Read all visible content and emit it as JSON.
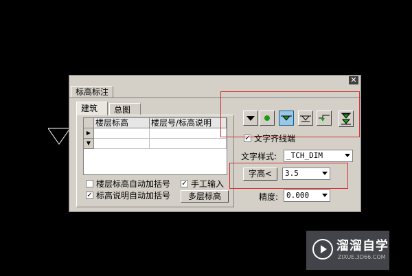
{
  "dialog": {
    "title_tab": "标高标注",
    "close_symbol": "✕"
  },
  "tabs": [
    "建筑",
    "总图"
  ],
  "grid": {
    "columns": [
      "楼层标高",
      "楼层号/标高说明"
    ],
    "row_markers": [
      "▶",
      "▼"
    ]
  },
  "options": {
    "auto_bracket_floor": {
      "label": "楼层标高自动加括号",
      "checked": false
    },
    "manual_input": {
      "label": "手工输入",
      "checked": true
    },
    "auto_bracket_note": {
      "label": "标高说明自动加括号",
      "checked": true
    },
    "multi_level_button": "多层标高"
  },
  "style_buttons": [
    {
      "name": "filled-down-triangle-icon",
      "selected": false
    },
    {
      "name": "circle-dot-icon",
      "selected": false
    },
    {
      "name": "flat-triangle-icon",
      "selected": true
    },
    {
      "name": "leader-triangle-icon",
      "selected": false
    },
    {
      "name": "step-triangle-icon",
      "selected": false
    },
    {
      "name": "double-triangle-icon",
      "selected": false
    }
  ],
  "text_align_end": {
    "label": "文字齐线端",
    "checked": true
  },
  "text_style": {
    "label": "文字样式:",
    "value": "_TCH_DIM"
  },
  "font_height": {
    "button": "字高<",
    "value": "3.5"
  },
  "precision": {
    "label": "精度:",
    "value": "0.000"
  },
  "watermark": {
    "title": "溜溜自学",
    "subtitle": "ZIXUE.3D66.COM"
  },
  "colors": {
    "accent_select": "#99c8e6",
    "highlight_red": "#d03030",
    "icon_green": "#1a9a1a"
  }
}
